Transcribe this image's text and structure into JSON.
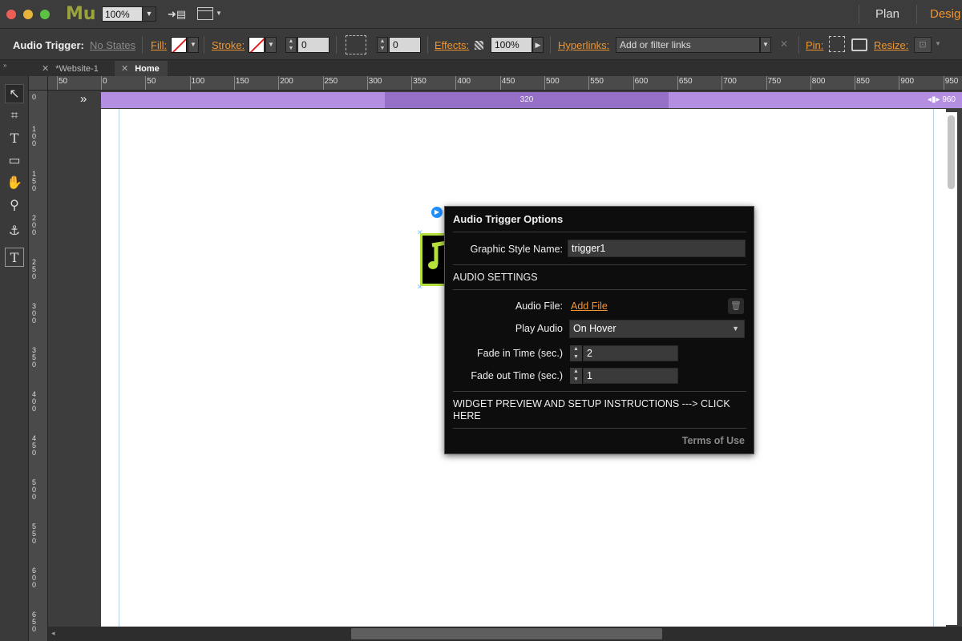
{
  "titlebar": {
    "app_logo": "Mu",
    "zoom": "100%",
    "mode_plan": "Plan",
    "mode_design": "Desig"
  },
  "controlbar": {
    "element_label": "Audio Trigger:",
    "states_label": "No States",
    "fill_label": "Fill:",
    "stroke_label": "Stroke:",
    "stroke_width": "0",
    "corner_radius": "0",
    "effects_label": "Effects:",
    "effects_value": "100%",
    "hyperlinks_label": "Hyperlinks:",
    "hyperlinks_placeholder": "Add or filter links",
    "pin_label": "Pin:",
    "resize_label": "Resize:"
  },
  "tabs": [
    {
      "label": "*Website-1",
      "active": false
    },
    {
      "label": "Home",
      "active": true
    }
  ],
  "ruler_h": [
    "50",
    "0",
    "50",
    "100",
    "150",
    "200",
    "250",
    "300",
    "350",
    "400",
    "450",
    "500",
    "550",
    "600",
    "650",
    "700",
    "750",
    "800",
    "850",
    "900",
    "950"
  ],
  "ruler_v": [
    "0",
    "100",
    "150",
    "200",
    "250",
    "300",
    "350",
    "400",
    "450",
    "500",
    "550",
    "600",
    "650"
  ],
  "breakpoint": {
    "center_value": "320",
    "right_value": "960"
  },
  "options_panel": {
    "title": "Audio Trigger Options",
    "graphic_style_label": "Graphic Style Name:",
    "graphic_style_value": "trigger1",
    "section_audio": "AUDIO SETTINGS",
    "audio_file_label": "Audio File:",
    "audio_file_link": "Add File",
    "play_audio_label": "Play Audio",
    "play_audio_value": "On Hover",
    "fade_in_label": "Fade in Time (sec.)",
    "fade_in_value": "2",
    "fade_out_label": "Fade out Time (sec.)",
    "fade_out_value": "1",
    "preview_text": "WIDGET PREVIEW AND SETUP INSTRUCTIONS ---> CLICK HERE",
    "terms_label": "Terms of Use"
  },
  "colors": {
    "accent_orange": "#f0952f",
    "breakpoint_purple": "#b48ee0",
    "widget_green": "#b5e13b"
  }
}
